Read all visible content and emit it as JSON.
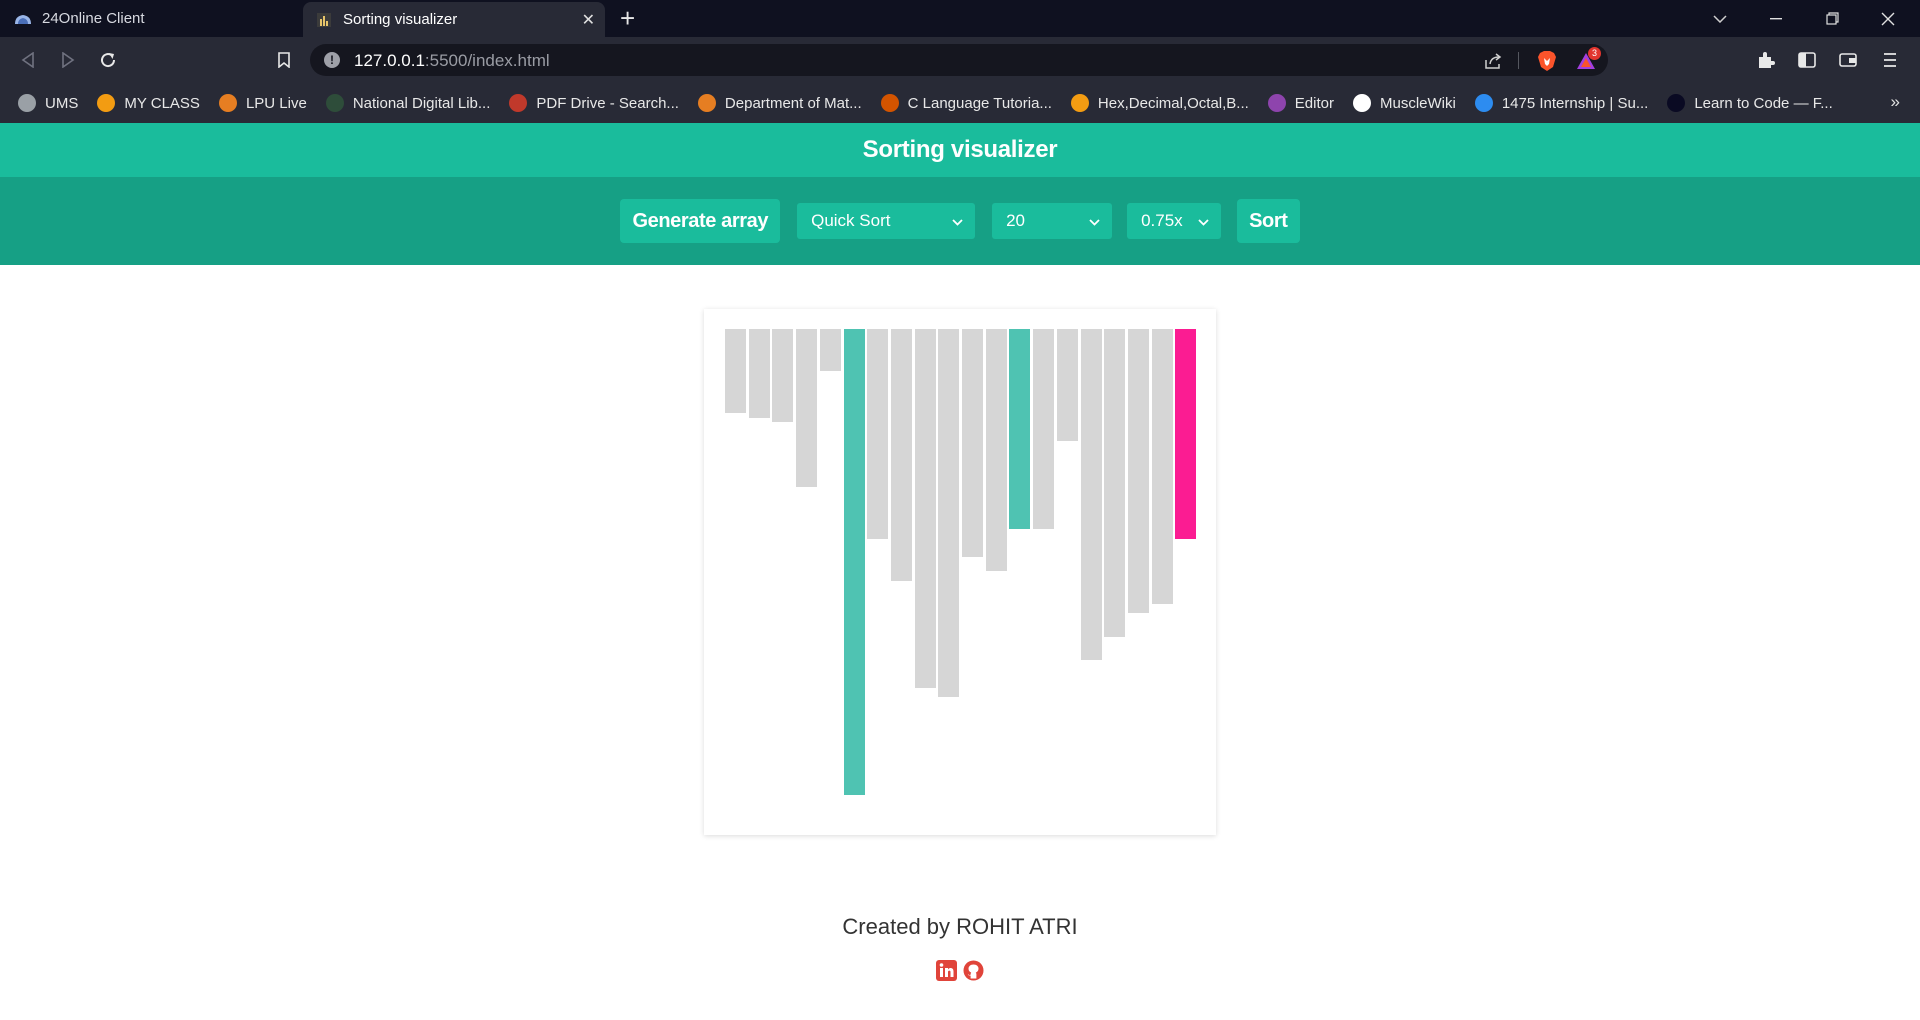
{
  "browser": {
    "tabs": [
      {
        "title": "24Online Client",
        "active": false,
        "icon": "cloud-icon"
      },
      {
        "title": "Sorting visualizer",
        "active": true,
        "icon": "page-favicon-icon"
      }
    ],
    "url_host": "127.0.0.1",
    "url_rest": ":5500/index.html",
    "shields_badge": "3",
    "bookmarks": [
      {
        "label": "UMS",
        "icon": "globe-icon",
        "color": "#9aa0a6"
      },
      {
        "label": "MY CLASS",
        "icon": "sun-icon",
        "color": "#f39c12"
      },
      {
        "label": "LPU Live",
        "icon": "basketball-icon",
        "color": "#e67e22"
      },
      {
        "label": "National Digital Lib...",
        "icon": "library-icon",
        "color": "#2e4d3a"
      },
      {
        "label": "PDF Drive - Search...",
        "icon": "pdf-icon",
        "color": "#c0392b"
      },
      {
        "label": "Department of Mat...",
        "icon": "m-logo-icon",
        "color": "#e67e22"
      },
      {
        "label": "C Language Tutoria...",
        "icon": "avatar-icon",
        "color": "#d35400"
      },
      {
        "label": "Hex,Decimal,Octal,B...",
        "icon": "r-logo-icon",
        "color": "#f39c12"
      },
      {
        "label": "Editor",
        "icon": "editor-icon",
        "color": "#8e44ad"
      },
      {
        "label": "MuscleWiki",
        "icon": "musclewiki-icon",
        "color": "#ffffff"
      },
      {
        "label": "1475 Internship | Su...",
        "icon": "is-logo-icon",
        "color": "#2d8cf0"
      },
      {
        "label": "Learn to Code — F...",
        "icon": "freecodecamp-icon",
        "color": "#0a0a23"
      }
    ]
  },
  "app": {
    "title": "Sorting visualizer",
    "generate_label": "Generate array",
    "algorithm": "Quick Sort",
    "size": "20",
    "speed": "0.75x",
    "sort_label": "Sort",
    "footer_text": "Created by ROHIT ATRI"
  },
  "colors": {
    "header": "#1abc9c",
    "controls": "#16a085",
    "bar_default": "#d6d6d6",
    "bar_compare": "#4fc3b2",
    "bar_pivot": "#fb1c92",
    "linkedin": "#e0443a",
    "github": "#e0443a"
  },
  "array": {
    "values": [
      18,
      19,
      20,
      34,
      9,
      100,
      45,
      54,
      77,
      79,
      49,
      52,
      43,
      43,
      24,
      71,
      66,
      61,
      59,
      45
    ],
    "states": [
      "default",
      "default",
      "default",
      "default",
      "default",
      "compare",
      "default",
      "default",
      "default",
      "default",
      "default",
      "default",
      "compare",
      "default",
      "default",
      "default",
      "default",
      "default",
      "default",
      "pivot"
    ],
    "max_value": 100
  }
}
